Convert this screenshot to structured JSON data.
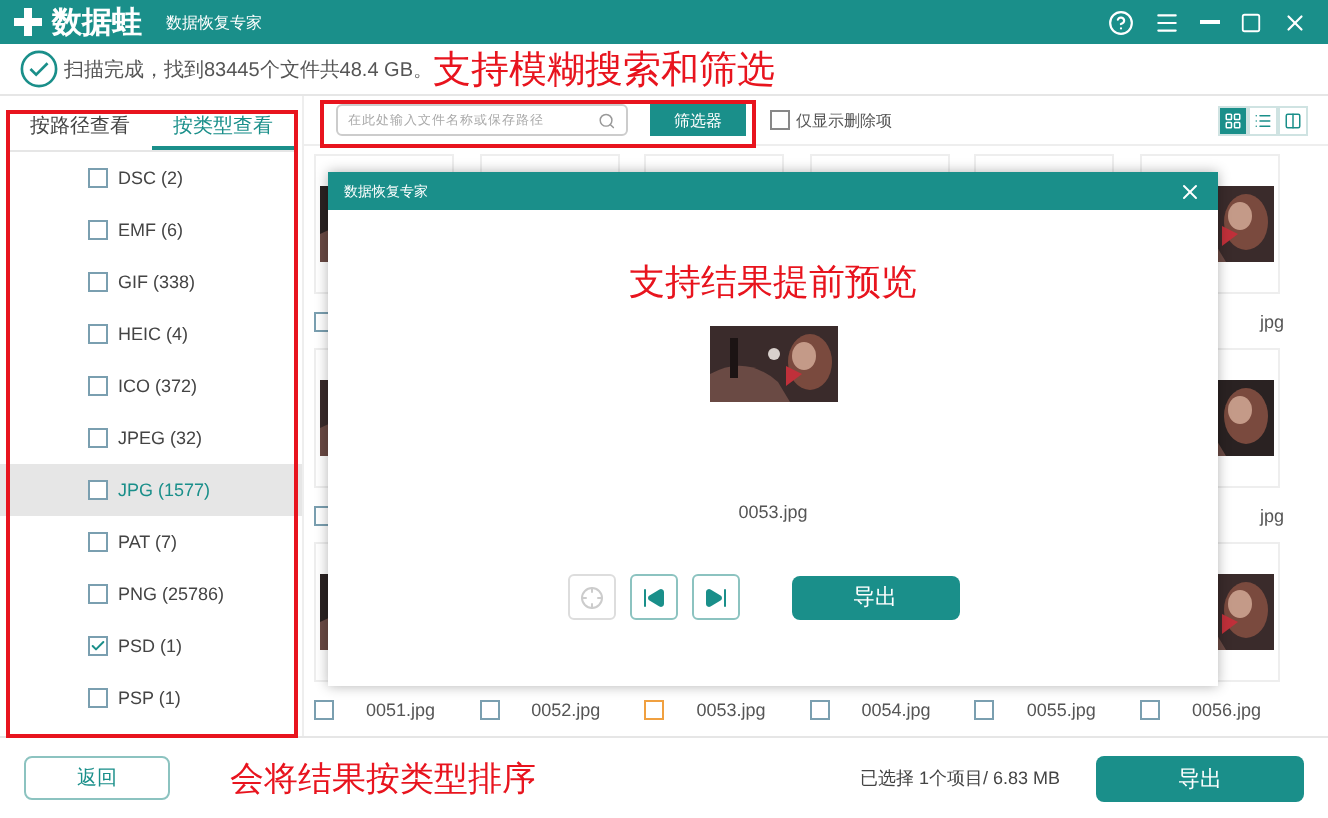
{
  "window": {
    "app_name": "数据蛙",
    "subtitle": "数据恢复专家"
  },
  "scan_status": "扫描完成，找到83445个文件共48.4 GB。",
  "annotations": {
    "search": "支持模糊搜索和筛选",
    "preview": "支持结果提前预览",
    "sort": "会将结果按类型排序"
  },
  "sidebar": {
    "tabs": [
      {
        "label": "按路径查看",
        "selected": false
      },
      {
        "label": "按类型查看",
        "selected": true
      }
    ],
    "items": [
      {
        "label": "DSC (2)",
        "checked": false,
        "selected": false
      },
      {
        "label": "EMF (6)",
        "checked": false,
        "selected": false
      },
      {
        "label": "GIF (338)",
        "checked": false,
        "selected": false
      },
      {
        "label": "HEIC (4)",
        "checked": false,
        "selected": false
      },
      {
        "label": "ICO (372)",
        "checked": false,
        "selected": false
      },
      {
        "label": "JPEG (32)",
        "checked": false,
        "selected": false
      },
      {
        "label": "JPG (1577)",
        "checked": false,
        "selected": true
      },
      {
        "label": "PAT (7)",
        "checked": false,
        "selected": false
      },
      {
        "label": "PNG (25786)",
        "checked": false,
        "selected": false
      },
      {
        "label": "PSD (1)",
        "checked": true,
        "selected": false
      },
      {
        "label": "PSP (1)",
        "checked": false,
        "selected": false
      }
    ]
  },
  "toolbar": {
    "search": {
      "placeholder": "在此处输入文件名称或保存路径"
    },
    "filter_button": "筛选器",
    "deleted_only": {
      "label": "仅显示删除项",
      "checked": false
    },
    "view_modes": [
      {
        "kind": "grid",
        "selected": true
      },
      {
        "kind": "list",
        "selected": false
      },
      {
        "kind": "detail",
        "selected": false
      }
    ]
  },
  "grid": {
    "rows": [
      {
        "cells": [
          {
            "kind": "picture",
            "checked": false
          },
          {},
          {},
          {},
          {},
          {
            "kind": "picture",
            "label": "jpg"
          }
        ]
      },
      {
        "cells": [
          {
            "kind": "picture",
            "checked": false
          },
          {},
          {},
          {},
          {},
          {
            "kind": "picture",
            "label": "jpg"
          }
        ]
      },
      {
        "cells": [
          {
            "kind": "picture",
            "checked": false,
            "highlighted": false,
            "label": "0051.jpg"
          },
          {
            "checked": false,
            "highlighted": false,
            "label": "0052.jpg"
          },
          {
            "checked": false,
            "highlighted": true,
            "label": "0053.jpg"
          },
          {
            "checked": false,
            "highlighted": false,
            "label": "0054.jpg"
          },
          {
            "checked": false,
            "highlighted": false,
            "label": "0055.jpg"
          },
          {
            "kind": "picture",
            "checked": false,
            "highlighted": false,
            "label": "0056.jpg"
          }
        ]
      }
    ]
  },
  "dialog": {
    "title": "数据恢复专家",
    "file_name": "0053.jpg",
    "buttons": [
      {
        "kind": "locate",
        "disabled": true
      },
      {
        "kind": "prev",
        "disabled": false
      },
      {
        "kind": "next",
        "disabled": false
      }
    ],
    "export_button": "导出"
  },
  "footer": {
    "back_button": "返回",
    "selection": "已选择 1个项目/ 6.83 MB",
    "export_button": "导出"
  }
}
